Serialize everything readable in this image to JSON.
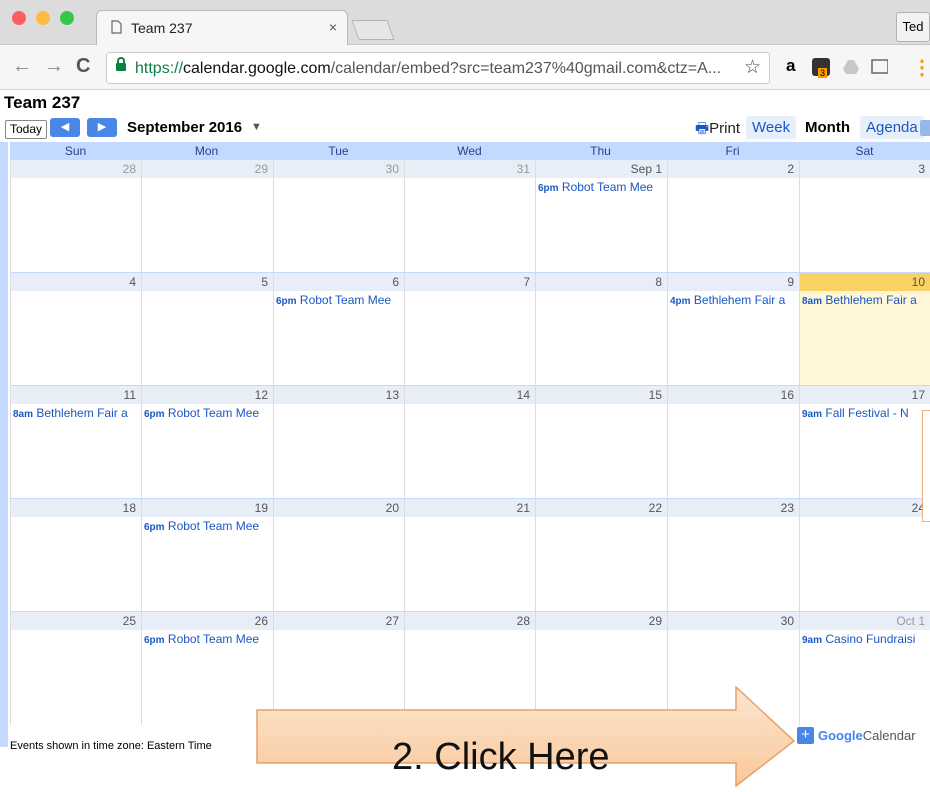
{
  "browser": {
    "tab_title": "Team 237",
    "tab_close": "×",
    "profile_name": "Ted",
    "nav": {
      "back": "←",
      "forward": "→",
      "reload": "C"
    },
    "url_scheme": "https://",
    "url_host": "calendar.google.com",
    "url_path": "/calendar/embed?src=team237%40gmail.com&ctz=A...",
    "star": "☆",
    "menu": "⋮",
    "extension_badge": "3"
  },
  "calendar": {
    "title": "Team 237",
    "today_label": "Today",
    "prev_label": "◀",
    "next_label": "▶",
    "month_label": "September 2016",
    "caret": "▼",
    "print_label": "Print",
    "views": {
      "week": "Week",
      "month": "Month",
      "agenda": "Agenda"
    },
    "day_names": [
      "Sun",
      "Mon",
      "Tue",
      "Wed",
      "Thu",
      "Fri",
      "Sat"
    ],
    "weeks": [
      [
        {
          "num": "28",
          "other": true,
          "event_time": "",
          "event_title": ""
        },
        {
          "num": "29",
          "other": true,
          "event_time": "",
          "event_title": ""
        },
        {
          "num": "30",
          "other": true,
          "event_time": "",
          "event_title": ""
        },
        {
          "num": "31",
          "other": true,
          "event_time": "",
          "event_title": ""
        },
        {
          "num": "Sep 1",
          "other": false,
          "event_time": "6pm",
          "event_title": "Robot Team Mee"
        },
        {
          "num": "2",
          "other": false,
          "event_time": "",
          "event_title": ""
        },
        {
          "num": "3",
          "other": false,
          "event_time": "",
          "event_title": ""
        }
      ],
      [
        {
          "num": "4",
          "other": false,
          "event_time": "",
          "event_title": ""
        },
        {
          "num": "5",
          "other": false,
          "event_time": "",
          "event_title": ""
        },
        {
          "num": "6",
          "other": false,
          "event_time": "6pm",
          "event_title": "Robot Team Mee"
        },
        {
          "num": "7",
          "other": false,
          "event_time": "",
          "event_title": ""
        },
        {
          "num": "8",
          "other": false,
          "event_time": "",
          "event_title": ""
        },
        {
          "num": "9",
          "other": false,
          "event_time": "4pm",
          "event_title": "Bethlehem Fair a"
        },
        {
          "num": "10",
          "other": false,
          "today": true,
          "event_time": "8am",
          "event_title": "Bethlehem Fair a"
        }
      ],
      [
        {
          "num": "11",
          "other": false,
          "event_time": "8am",
          "event_title": "Bethlehem Fair a"
        },
        {
          "num": "12",
          "other": false,
          "event_time": "6pm",
          "event_title": "Robot Team Mee"
        },
        {
          "num": "13",
          "other": false,
          "event_time": "",
          "event_title": ""
        },
        {
          "num": "14",
          "other": false,
          "event_time": "",
          "event_title": ""
        },
        {
          "num": "15",
          "other": false,
          "event_time": "",
          "event_title": ""
        },
        {
          "num": "16",
          "other": false,
          "event_time": "",
          "event_title": ""
        },
        {
          "num": "17",
          "other": false,
          "event_time": "9am",
          "event_title": "Fall Festival - N"
        }
      ],
      [
        {
          "num": "18",
          "other": false,
          "event_time": "",
          "event_title": ""
        },
        {
          "num": "19",
          "other": false,
          "event_time": "6pm",
          "event_title": "Robot Team Mee"
        },
        {
          "num": "20",
          "other": false,
          "event_time": "",
          "event_title": ""
        },
        {
          "num": "21",
          "other": false,
          "event_time": "",
          "event_title": ""
        },
        {
          "num": "22",
          "other": false,
          "event_time": "",
          "event_title": ""
        },
        {
          "num": "23",
          "other": false,
          "event_time": "",
          "event_title": ""
        },
        {
          "num": "24",
          "other": false,
          "event_time": "",
          "event_title": ""
        }
      ],
      [
        {
          "num": "25",
          "other": false,
          "event_time": "",
          "event_title": ""
        },
        {
          "num": "26",
          "other": false,
          "event_time": "6pm",
          "event_title": "Robot Team Mee"
        },
        {
          "num": "27",
          "other": false,
          "event_time": "",
          "event_title": ""
        },
        {
          "num": "28",
          "other": false,
          "event_time": "",
          "event_title": ""
        },
        {
          "num": "29",
          "other": false,
          "event_time": "",
          "event_title": ""
        },
        {
          "num": "30",
          "other": false,
          "event_time": "",
          "event_title": ""
        },
        {
          "num": "Oct 1",
          "other": true,
          "event_time": "9am",
          "event_title": "Casino Fundraisi"
        }
      ]
    ],
    "footer_timezone": "Events shown in time zone: Eastern Time",
    "gcal_plus": "+",
    "gcal_brand": "Google",
    "gcal_suffix": "Calendar"
  },
  "callout": {
    "text": "2. Click Here"
  },
  "colors": {
    "accent": "#4a86e8",
    "today": "#fad163",
    "header": "#c3d9ff",
    "callout_fill": "#fbd6b4"
  }
}
